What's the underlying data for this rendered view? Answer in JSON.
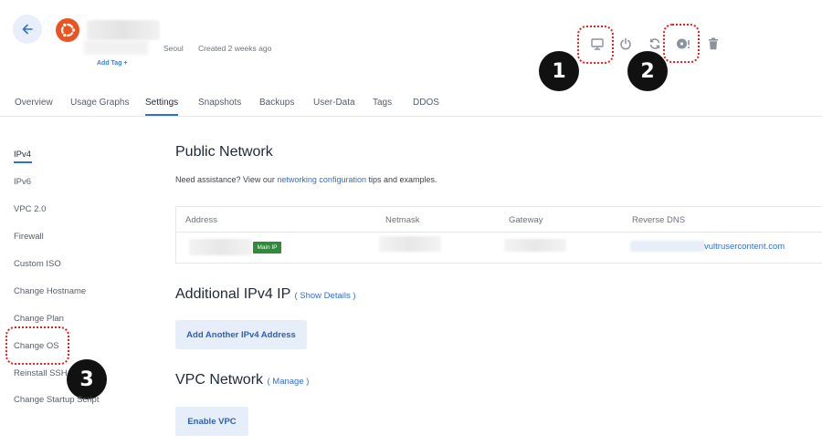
{
  "header": {
    "add_tag_label": "Add Tag +",
    "location": "Seoul",
    "created": "Created 2 weeks ago"
  },
  "badges": [
    "1",
    "2",
    "3"
  ],
  "tabs": [
    {
      "label": "Overview"
    },
    {
      "label": "Usage Graphs"
    },
    {
      "label": "Settings"
    },
    {
      "label": "Snapshots"
    },
    {
      "label": "Backups"
    },
    {
      "label": "User-Data"
    },
    {
      "label": "Tags"
    },
    {
      "label": "DDOS"
    }
  ],
  "sidebar": {
    "items": [
      {
        "label": "IPv4"
      },
      {
        "label": "IPv6"
      },
      {
        "label": "VPC 2.0"
      },
      {
        "label": "Firewall"
      },
      {
        "label": "Custom ISO"
      },
      {
        "label": "Change Hostname"
      },
      {
        "label": "Change Plan"
      },
      {
        "label": "Change OS"
      },
      {
        "label": "Reinstall SSH"
      },
      {
        "label": "Change Startup Script"
      }
    ]
  },
  "public_network": {
    "title": "Public Network",
    "assist_prefix": "Need assistance? View our ",
    "assist_link": "networking configuration",
    "assist_suffix": " tips and examples.",
    "columns": [
      "Address",
      "Netmask",
      "Gateway",
      "Reverse DNS"
    ],
    "main_ip_badge": "Main IP",
    "reverse_dns_suffix": "vultrusercontent.com"
  },
  "additional_ip": {
    "title": "Additional IPv4 IP",
    "toggle": "( Show Details )",
    "button": "Add Another IPv4 Address"
  },
  "vpc": {
    "title": "VPC Network",
    "toggle": "( Manage )",
    "button": "Enable VPC"
  },
  "colors": {
    "accent": "#2f6fd8",
    "ubuntu": "#e95420",
    "main_ip": "#2e8b3a",
    "annotation": "#e62020"
  }
}
